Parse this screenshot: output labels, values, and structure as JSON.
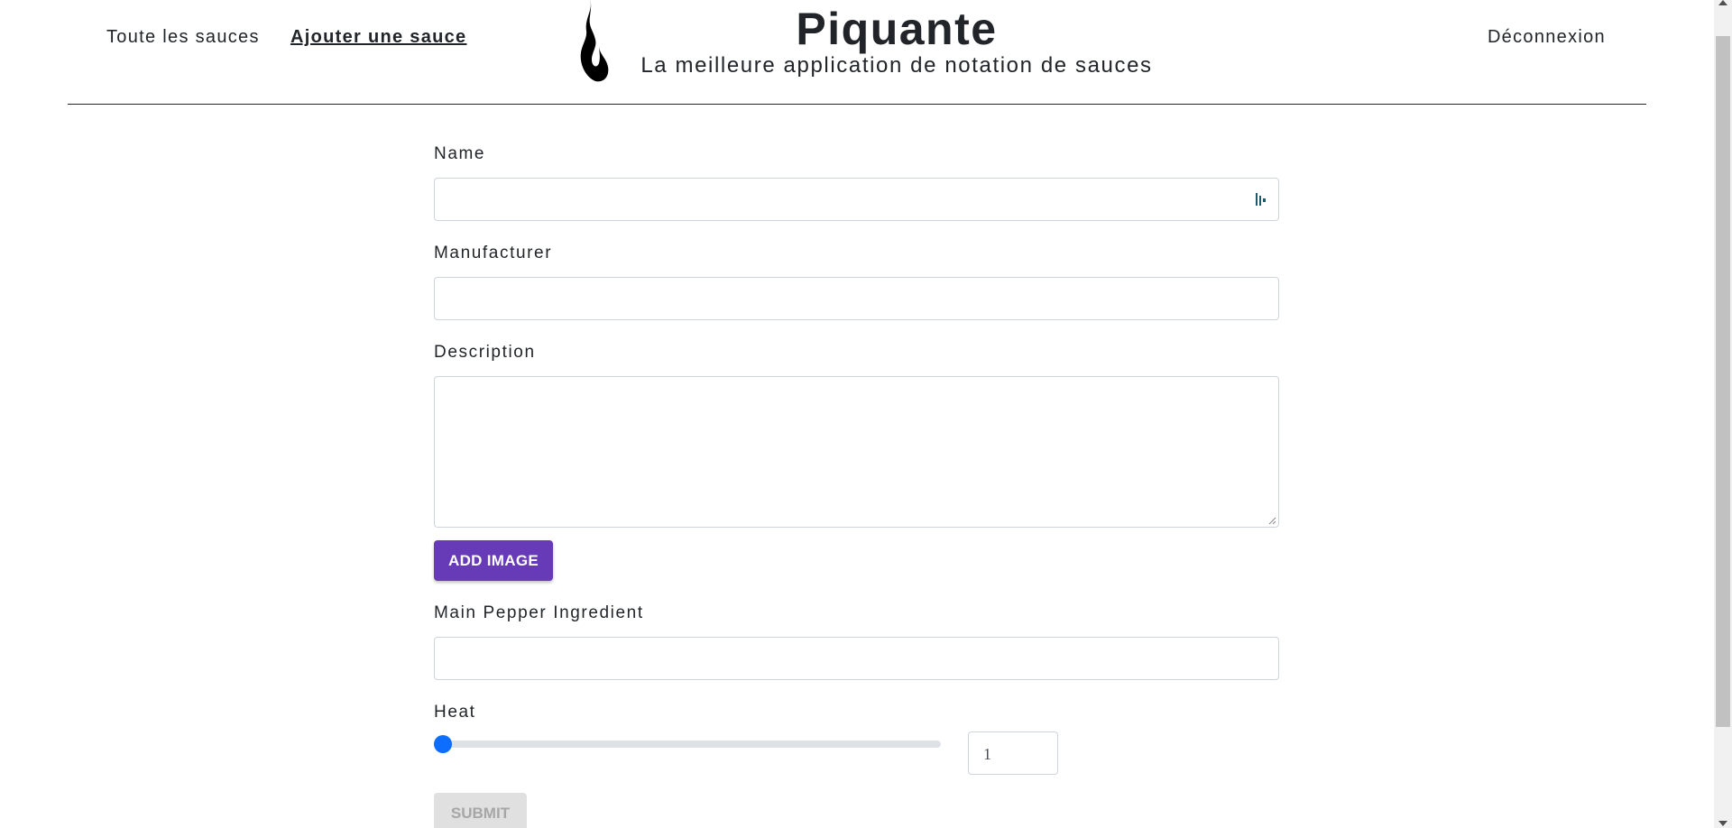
{
  "nav": {
    "all_sauces": "Toute les sauces",
    "add_sauce": "Ajouter une sauce",
    "logout": "Déconnexion"
  },
  "brand": {
    "title": "Piquante",
    "subtitle": "La meilleure application de notation de sauces",
    "logo_icon": "flame-icon"
  },
  "form": {
    "name_label": "Name",
    "name_value": "",
    "manufacturer_label": "Manufacturer",
    "manufacturer_value": "",
    "description_label": "Description",
    "description_value": "",
    "add_image_label": "ADD IMAGE",
    "pepper_label": "Main Pepper Ingredient",
    "pepper_value": "",
    "heat_label": "Heat",
    "heat_value": "1",
    "heat_slider_fraction": 0,
    "submit_label": "SUBMIT"
  },
  "colors": {
    "primary_button": "#673ab7",
    "slider_thumb": "#0d6efd",
    "disabled_button": "#e0e0e0"
  }
}
